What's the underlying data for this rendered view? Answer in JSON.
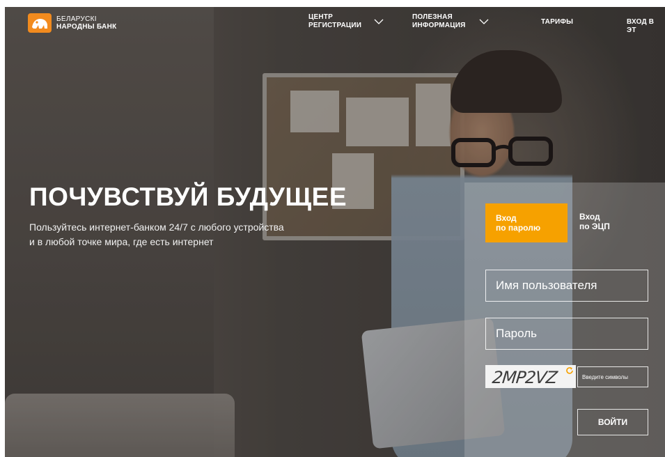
{
  "brand": {
    "line1": "БЕЛАРУСКІ",
    "line2": "НАРОДНЫ БАНК",
    "accent": "#f6a100"
  },
  "nav": {
    "registration": "ЦЕНТР\nРЕГИСТРАЦИИ",
    "info": "ПОЛЕЗНАЯ\nИНФОРМАЦИЯ",
    "tariffs": "ТАРИФЫ",
    "login_cut": "ВХОД В ЭТ"
  },
  "hero": {
    "title": "ПОЧУВСТВУЙ БУДУЩЕЕ",
    "subtitle_line1": "Пользуйтесь интернет-банком 24/7 с любого устройства",
    "subtitle_line2": "и в любой точке мира, где есть интернет"
  },
  "login": {
    "tab_password_line1": "Вход",
    "tab_password_line2": "по паролю",
    "tab_ecp_line1": "Вход",
    "tab_ecp_line2": "по ЭЦП",
    "username_placeholder": "Имя пользователя",
    "password_placeholder": "Пароль",
    "captcha_text": "2MP2VZ",
    "captcha_placeholder": "Введите символы",
    "submit_label": "ВОЙТИ"
  },
  "icons": {
    "logo": "lion-logo-icon",
    "chevron": "chevron-down-icon",
    "refresh": "refresh-icon"
  }
}
